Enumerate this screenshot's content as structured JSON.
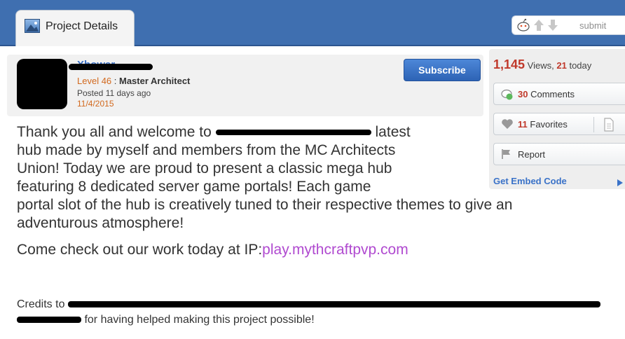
{
  "tab": {
    "label": "Project Details",
    "icon": "image-icon"
  },
  "voting": {
    "submit_label": "submit"
  },
  "author": {
    "name": "Xhowar",
    "level": "Level 46",
    "separator": " : ",
    "rank": "Master Architect",
    "posted": "Posted 11 days ago",
    "date": "11/4/2015"
  },
  "subscribe_label": "Subscribe",
  "stats": {
    "views": "1,145",
    "views_label": "Views,",
    "today_count": "21",
    "today_label": "today",
    "comments_count": "30",
    "comments_label": "Comments",
    "favorites_count": "11",
    "favorites_label": "Favorites",
    "report_label": "Report",
    "embed_label": "Get Embed Code"
  },
  "description": {
    "l1_a": "Thank you all and welcome to",
    "l1_b": "latest",
    "l2": "hub made by myself and members from the MC Architects",
    "l3": "Union! Today we are proud to present a classic mega hub",
    "l4": "featuring 8 dedicated server game portals! Each game",
    "l5": "portal slot of the hub is creatively tuned to their respective themes to give an",
    "l6": "adventurous atmosphere!",
    "ip_prefix": "Come check out our work today at IP:",
    "ip_value": "play.mythcraftpvp.com"
  },
  "credits": {
    "prefix": "Credits to",
    "suffix": "for having helped making this project possible!"
  },
  "colors": {
    "accent_blue": "#3f6fb0",
    "count_red": "#c0392b",
    "level_orange": "#d2691e",
    "ip_purple": "#b04ad0"
  }
}
